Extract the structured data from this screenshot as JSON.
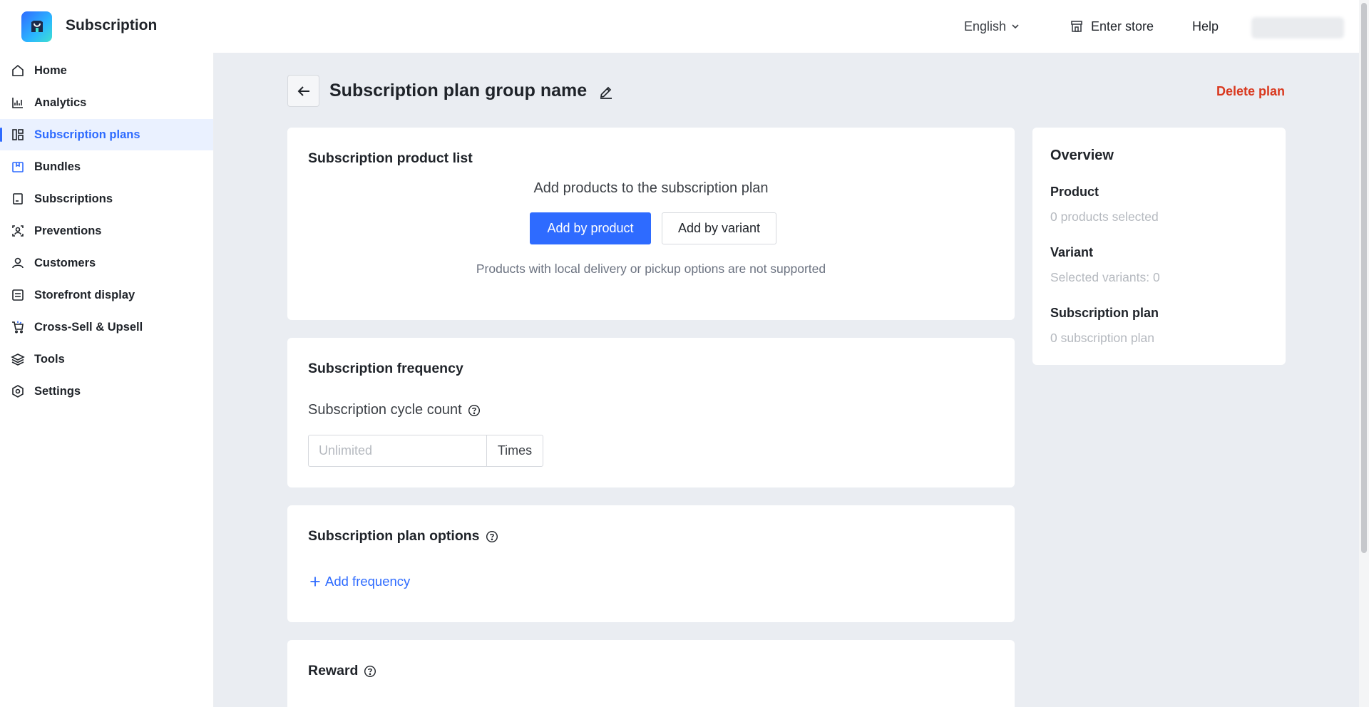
{
  "app": {
    "title": "Subscription"
  },
  "header": {
    "language": "English",
    "enter_store": "Enter store",
    "help": "Help"
  },
  "sidebar": {
    "items": [
      {
        "label": "Home",
        "icon": "home-icon",
        "active": false
      },
      {
        "label": "Analytics",
        "icon": "analytics-icon",
        "active": false
      },
      {
        "label": "Subscription plans",
        "icon": "plans-icon",
        "active": true
      },
      {
        "label": "Bundles",
        "icon": "bundle-icon",
        "active": false
      },
      {
        "label": "Subscriptions",
        "icon": "document-icon",
        "active": false
      },
      {
        "label": "Preventions",
        "icon": "user-shield-icon",
        "active": false
      },
      {
        "label": "Customers",
        "icon": "user-icon",
        "active": false
      },
      {
        "label": "Storefront display",
        "icon": "display-icon",
        "active": false
      },
      {
        "label": "Cross-Sell & Upsell",
        "icon": "cart-icon",
        "active": false
      },
      {
        "label": "Tools",
        "icon": "layers-icon",
        "active": false
      },
      {
        "label": "Settings",
        "icon": "settings-icon",
        "active": false
      }
    ]
  },
  "page": {
    "title": "Subscription plan group name",
    "delete_label": "Delete plan"
  },
  "product_list": {
    "title": "Subscription product list",
    "subtitle": "Add products to the subscription plan",
    "add_by_product": "Add by product",
    "add_by_variant": "Add by variant",
    "note": "Products with local delivery or pickup options are not supported"
  },
  "frequency": {
    "title": "Subscription frequency",
    "cycle_label": "Subscription cycle count",
    "cycle_placeholder": "Unlimited",
    "cycle_value": "",
    "cycle_suffix": "Times"
  },
  "plan_options": {
    "title": "Subscription plan options",
    "add_frequency": "Add frequency"
  },
  "reward": {
    "title": "Reward"
  },
  "overview": {
    "title": "Overview",
    "product_label": "Product",
    "product_value": "0 products selected",
    "variant_label": "Variant",
    "variant_value": "Selected variants: 0",
    "plan_label": "Subscription plan",
    "plan_value": "0 subscription plan"
  },
  "colors": {
    "accent": "#2e6bff",
    "danger": "#d9381e",
    "main_bg": "#eaedf2",
    "active_bg": "#eaf1ff"
  }
}
